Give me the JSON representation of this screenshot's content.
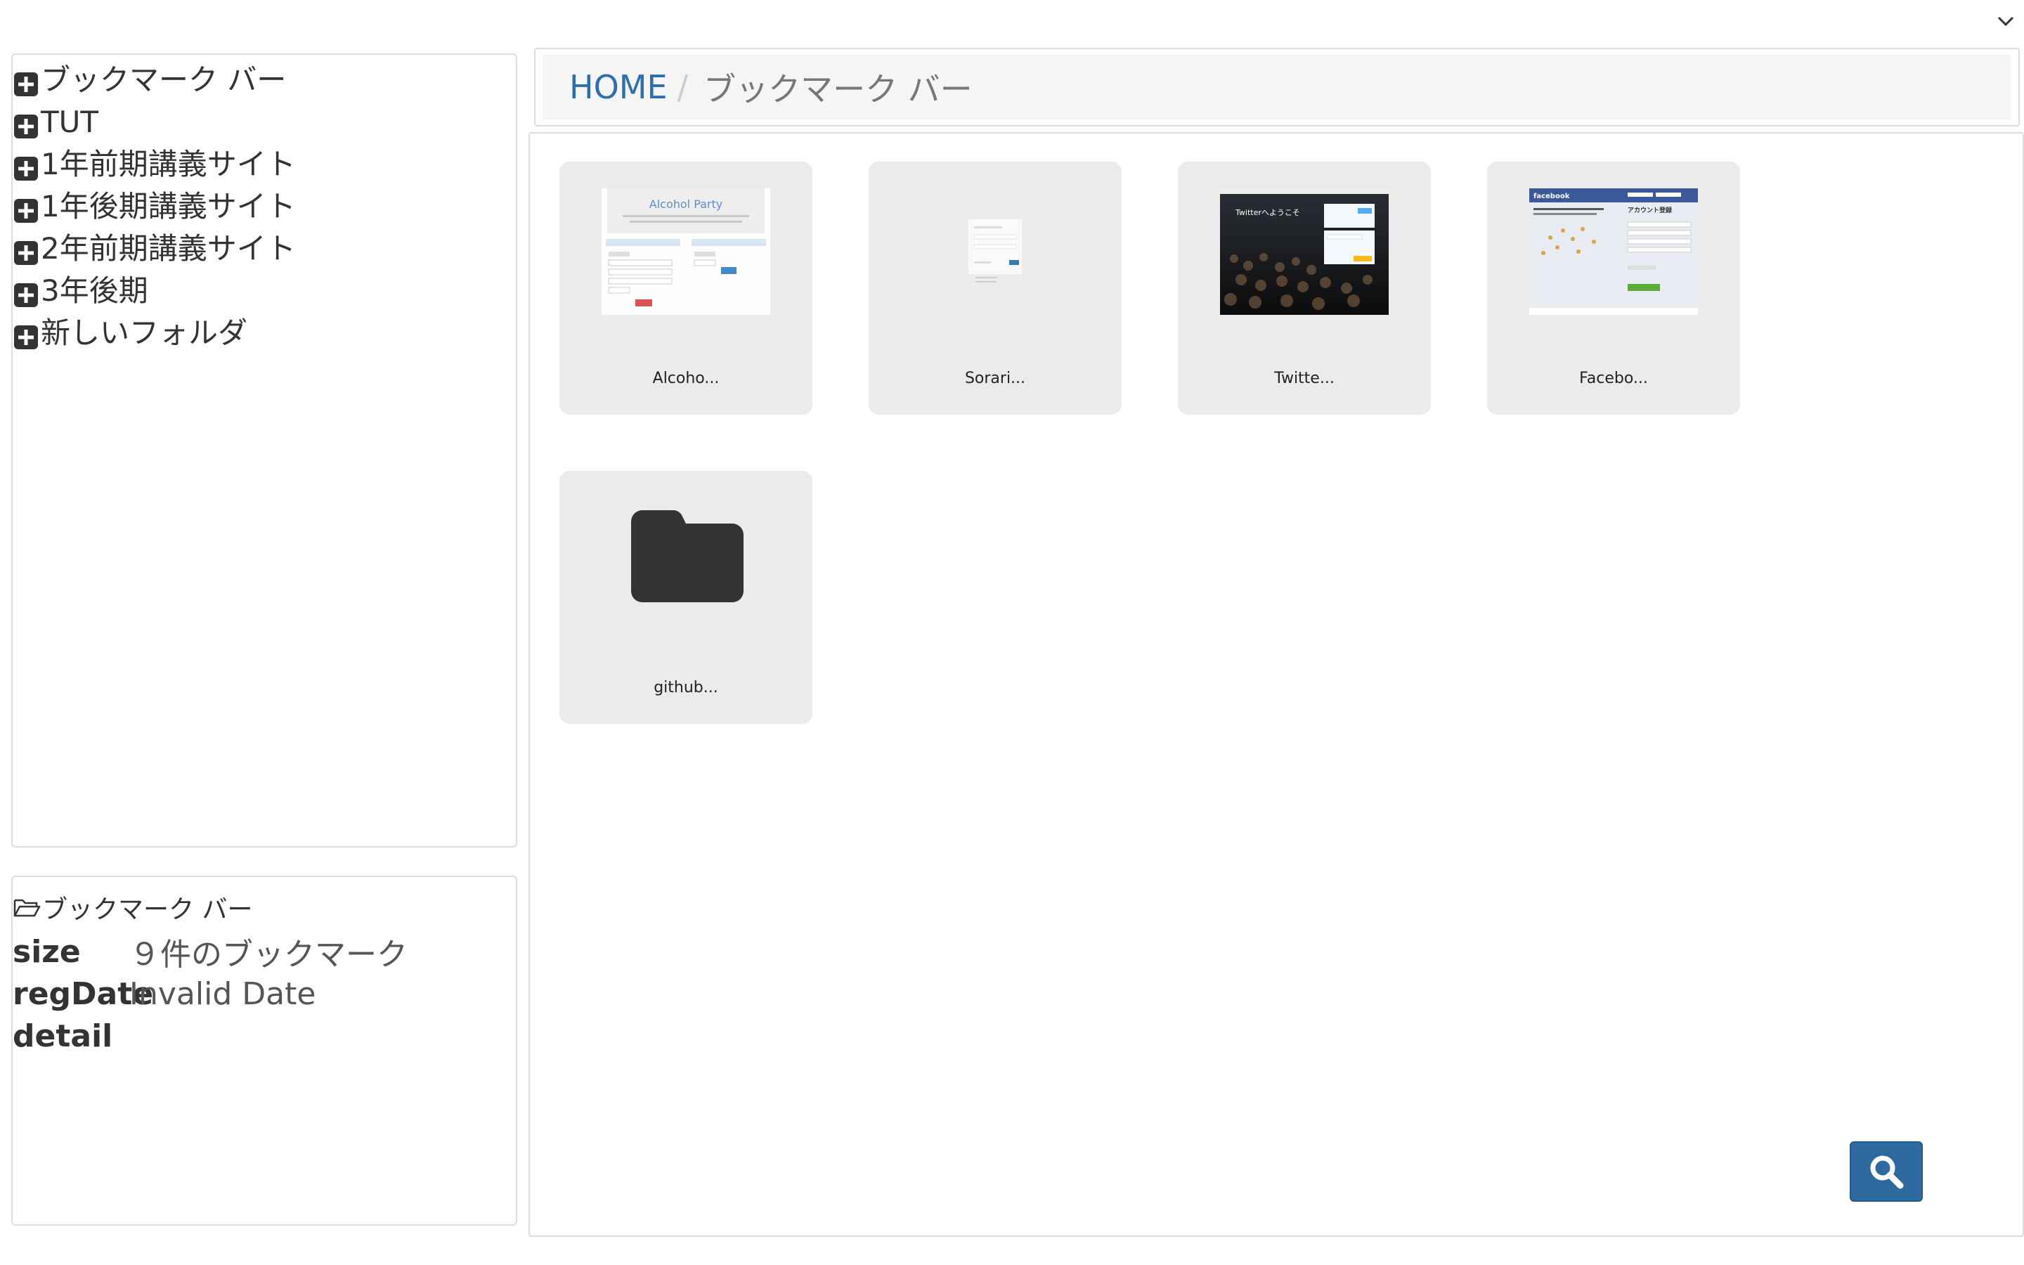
{
  "tree": {
    "items": [
      {
        "label": "ブックマーク バー"
      },
      {
        "label": "TUT"
      },
      {
        "label": "1年前期講義サイト"
      },
      {
        "label": "1年後期講義サイト"
      },
      {
        "label": "2年前期講義サイト"
      },
      {
        "label": "3年後期"
      },
      {
        "label": "新しいフォルダ"
      }
    ]
  },
  "info": {
    "folder_name": "ブックマーク バー",
    "size_key": "size",
    "size_value": "９件のブックマーク",
    "regdate_key": "regDate",
    "regdate_value": "Invalid Date",
    "detail_key": "detail"
  },
  "breadcrumb": {
    "home": "HOME",
    "separator": "/",
    "current": "ブックマーク バー"
  },
  "thumbs": {
    "alcohol_title": "Alcohol Party",
    "twitter_title": "Twitterへようこそ",
    "facebook_brand": "facebook",
    "facebook_heading": "アカウント登録"
  },
  "cards": [
    {
      "label": "Alcoho...",
      "type": "bookmark"
    },
    {
      "label": "Sorari...",
      "type": "bookmark"
    },
    {
      "label": "Twitte...",
      "type": "bookmark"
    },
    {
      "label": "Facebo...",
      "type": "bookmark"
    },
    {
      "label": "github...",
      "type": "folder"
    }
  ],
  "icons": {
    "tree_expand": "plus-square-icon",
    "info_folder": "folder-open-icon",
    "card_folder": "folder-icon",
    "search": "search-icon",
    "top_menu": "chevron-down-icon"
  },
  "colors": {
    "link": "#2a6fb0",
    "search_button": "#2c6aa0",
    "card_bg": "#ebebeb",
    "breadcrumb_bg": "#f5f5f5"
  }
}
